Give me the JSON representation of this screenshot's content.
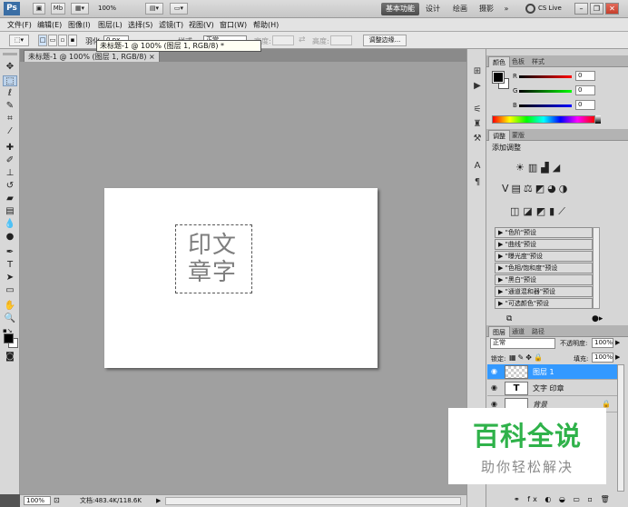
{
  "appbar": {
    "logo": "Ps",
    "br_label": "Br",
    "mb_label": "Mb",
    "zoom": "100%",
    "workspaces": [
      "基本功能",
      "设计",
      "绘画",
      "摄影",
      "»"
    ],
    "cslive": "CS Live"
  },
  "menu": [
    "文件(F)",
    "编辑(E)",
    "图像(I)",
    "图层(L)",
    "选择(S)",
    "滤镜(T)",
    "视图(V)",
    "窗口(W)",
    "帮助(H)"
  ],
  "options": {
    "feather_label": "羽化:",
    "feather_value": "0 px",
    "style_label": "样式:",
    "style_value": "正常",
    "width_label": "宽度:",
    "height_label": "高度:",
    "refine_edge": "调整边缘..."
  },
  "document": {
    "tab_title": "未标题-1 @ 100% (图层 1, RGB/8)",
    "tooltip": "未标题-1 @ 100% (图层 1, RGB/8) *",
    "stamp_line1": "印文",
    "stamp_line2": "章字"
  },
  "status": {
    "zoom": "100%",
    "doc_size": "文档:483.4K/118.6K"
  },
  "color_panel": {
    "tabs": [
      "颜色",
      "色板",
      "样式"
    ],
    "labels": [
      "R",
      "G",
      "B"
    ],
    "values": [
      "0",
      "0",
      "0"
    ]
  },
  "adjustments_panel": {
    "tabs": [
      "调整",
      "蒙版"
    ],
    "title": "添加调整",
    "presets": [
      "\"色阶\"预设",
      "\"曲线\"预设",
      "\"曝光度\"预设",
      "\"色相/饱和度\"预设",
      "\"黑白\"预设",
      "\"通道混和器\"预设",
      "\"可选颜色\"预设"
    ]
  },
  "layers_panel": {
    "tabs": [
      "图层",
      "通道",
      "路径"
    ],
    "blend_mode": "正常",
    "opacity_label": "不透明度:",
    "opacity": "100%",
    "lock_label": "锁定:",
    "fill_label": "填充:",
    "fill": "100%",
    "layers": [
      {
        "name": "图层 1",
        "selected": true
      },
      {
        "name": "文字 印章",
        "type": "T"
      },
      {
        "name": "背景",
        "locked": true
      }
    ]
  },
  "watermark": {
    "title": "百科全说",
    "subtitle": "助你轻松解决"
  },
  "colors": {
    "accent": "#3399ff",
    "watermark_green": "#2fb24a"
  }
}
